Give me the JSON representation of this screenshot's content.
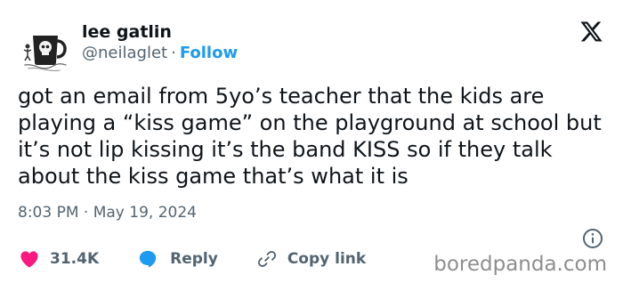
{
  "author": {
    "name": "lee gatlin",
    "handle": "@neilaglet",
    "separator": "·",
    "follow_label": "Follow"
  },
  "tweet": {
    "text": "got an email from 5yo’s teacher that the kids are playing a “kiss game” on the playground at school but it’s not lip kissing it’s the band KISS so if they talk about the kiss game that’s what it is",
    "timestamp": "8:03 PM · May 19, 2024"
  },
  "actions": {
    "likes_count": "31.4K",
    "reply_label": "Reply",
    "copy_link_label": "Copy link"
  },
  "watermark": "boredpanda.com",
  "icons": {
    "brand": "x-logo-icon",
    "like": "heart-icon",
    "reply": "speech-bubble-icon",
    "copy": "link-icon",
    "info": "info-icon"
  },
  "colors": {
    "text": "#0f1419",
    "secondary": "#536471",
    "accent": "#1d9bf0",
    "like": "#f91880",
    "watermark": "#8e8e8e"
  }
}
